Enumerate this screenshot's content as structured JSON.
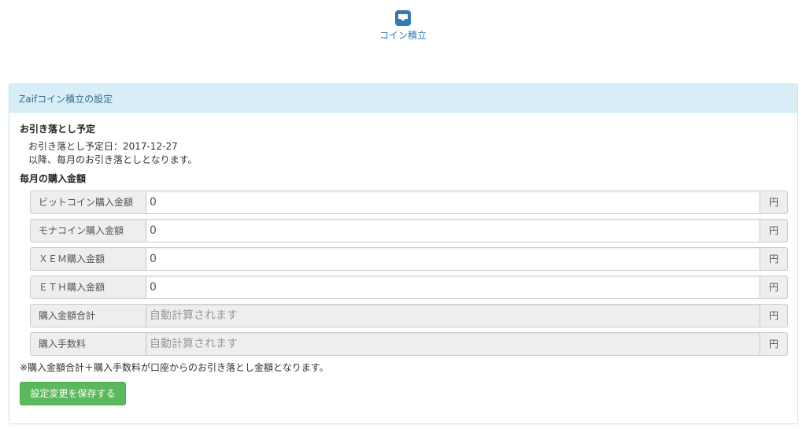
{
  "nav": {
    "active_item": {
      "label": "コイン積立",
      "icon": "inbox-icon",
      "color": "#337ab7"
    }
  },
  "panel": {
    "title": "Zaifコイン積立の設定",
    "debit_section": {
      "title": "お引き落とし予定",
      "date_line": "お引き落とし予定日：2017-12-27",
      "info_line": "以降、毎月のお引き落としとなります。"
    },
    "monthly_section": {
      "title": "毎月の購入金額",
      "rows": [
        {
          "label": "ビットコイン購入金額",
          "value": "0",
          "placeholder": "",
          "unit": "円"
        },
        {
          "label": "モナコイン購入金額",
          "value": "0",
          "placeholder": "",
          "unit": "円"
        },
        {
          "label": "ＸＥＭ購入金額",
          "value": "0",
          "placeholder": "",
          "unit": "円"
        },
        {
          "label": "ＥＴＨ購入金額",
          "value": "0",
          "placeholder": "",
          "unit": "円"
        },
        {
          "label": "購入金額合計",
          "value": "",
          "placeholder": "自動計算されます",
          "unit": "円"
        },
        {
          "label": "購入手数料",
          "value": "",
          "placeholder": "自動計算されます",
          "unit": "円"
        }
      ]
    },
    "note": "※購入金額合計＋購入手数料が口座からのお引き落とし金額となります。",
    "save_label": "設定変更を保存する"
  },
  "colors": {
    "panel_heading_bg": "#d9edf7",
    "panel_border": "#bce8f1",
    "heading_text": "#31708f",
    "save_button": "#5cb85c"
  }
}
